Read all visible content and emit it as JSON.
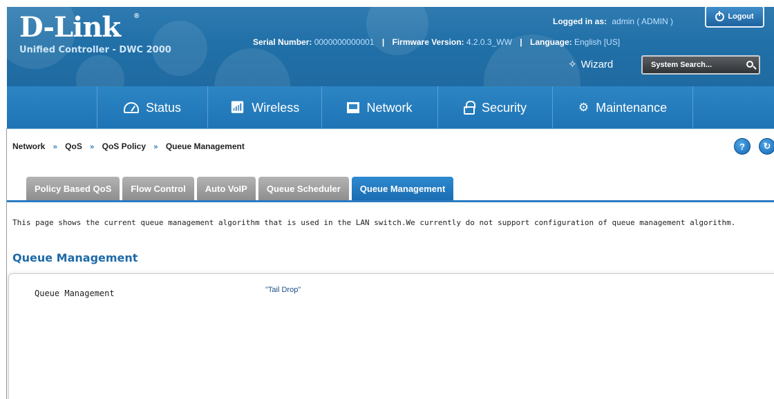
{
  "brand": {
    "logo": "D-Link",
    "registered": "®",
    "product": "Unified Controller - DWC 2000"
  },
  "header": {
    "logged_in_label": "Logged in as:",
    "logged_in_value": "admin ( ADMIN )",
    "logout_label": "Logout",
    "serial_label": "Serial Number:",
    "serial_value": "0000000000001",
    "firmware_label": "Firmware Version:",
    "firmware_value": "4.2.0.3_WW",
    "language_label": "Language:",
    "language_value": "English [US]",
    "separator": "|",
    "wizard_label": "Wizard",
    "search_placeholder": "System Search..."
  },
  "nav": {
    "items": [
      {
        "label": "Status",
        "icon": "dashboard-icon"
      },
      {
        "label": "Wireless",
        "icon": "wifi-icon"
      },
      {
        "label": "Network",
        "icon": "network-icon"
      },
      {
        "label": "Security",
        "icon": "lock-icon"
      },
      {
        "label": "Maintenance",
        "icon": "gear-icon"
      }
    ]
  },
  "breadcrumb": {
    "items": [
      "Network",
      "QoS",
      "QoS Policy",
      "Queue Management"
    ],
    "arrow": "»"
  },
  "tabs": [
    {
      "label": "Policy Based QoS",
      "active": false
    },
    {
      "label": "Flow Control",
      "active": false
    },
    {
      "label": "Auto VoIP",
      "active": false
    },
    {
      "label": "Queue Scheduler",
      "active": false
    },
    {
      "label": "Queue Management",
      "active": true
    }
  ],
  "page": {
    "description": "This page shows the current queue management algorithm that is used in the LAN switch.We currently do not support configuration of queue management algorithm.",
    "section_title": "Queue Management",
    "field_label": "Queue Management",
    "field_value": "\"Tail Drop\""
  },
  "colors": {
    "header_blue": "#2170a8",
    "nav_blue": "#1e74b5",
    "accent": "#2a7cc0",
    "tab_inactive": "#8e8e8e"
  }
}
